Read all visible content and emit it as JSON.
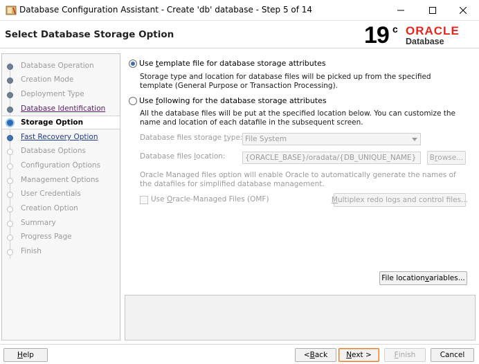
{
  "window": {
    "title": "Database Configuration Assistant - Create 'db' database - Step 5 of 14",
    "controls": [
      "minimize-icon",
      "maximize-icon",
      "close-icon"
    ]
  },
  "header": {
    "page_title": "Select Database Storage Option",
    "logo": {
      "version": "19",
      "version_sup": "c",
      "brand": "ORACLE",
      "product": "Database"
    }
  },
  "sidebar": {
    "steps": [
      {
        "label": "Database Operation",
        "state": "done"
      },
      {
        "label": "Creation Mode",
        "state": "done"
      },
      {
        "label": "Deployment Type",
        "state": "done"
      },
      {
        "label": "Database Identification",
        "state": "visited"
      },
      {
        "label": "Storage Option",
        "state": "current"
      },
      {
        "label": "Fast Recovery Option",
        "state": "next"
      },
      {
        "label": "Database Options",
        "state": "pending"
      },
      {
        "label": "Configuration Options",
        "state": "pending"
      },
      {
        "label": "Management Options",
        "state": "pending"
      },
      {
        "label": "User Credentials",
        "state": "pending"
      },
      {
        "label": "Creation Option",
        "state": "pending"
      },
      {
        "label": "Summary",
        "state": "pending"
      },
      {
        "label": "Progress Page",
        "state": "pending"
      },
      {
        "label": "Finish",
        "state": "pending"
      }
    ]
  },
  "main": {
    "option_template": {
      "pre": "Use ",
      "mnemonic": "t",
      "post": "emplate file for database storage attributes",
      "selected": true,
      "description": "Storage type and location for database files will be picked up from the specified template (General Purpose or Transaction Processing)."
    },
    "option_following": {
      "pre": "Use ",
      "mnemonic": "f",
      "post": "ollowing for the database storage attributes",
      "selected": false,
      "description": "All the database files will be put at the specified location below. You can customize the name and location of each datafile in the subsequent screen."
    },
    "storage_type": {
      "pre": "Database files storage ",
      "mnemonic": "t",
      "post": "ype:",
      "value": "File System"
    },
    "files_location": {
      "pre": "Database files ",
      "mnemonic": "l",
      "post": "ocation:",
      "value": "{ORACLE_BASE}/oradata/{DB_UNIQUE_NAME}"
    },
    "browse": {
      "pre": "B",
      "mnemonic": "r",
      "post": "owse..."
    },
    "omf_note": "Oracle Managed files option will enable Oracle to automatically generate the names of the datafiles for simplified database management.",
    "omf_checkbox": {
      "pre": "Use ",
      "mnemonic": "O",
      "post": "racle-Managed Files (OMF)",
      "checked": false
    },
    "multiplex": {
      "pre": "",
      "mnemonic": "M",
      "post": "ultiplex redo logs and control files..."
    },
    "file_location_vars": {
      "pre": "File location ",
      "mnemonic": "v",
      "post": "ariables..."
    }
  },
  "footer": {
    "help": {
      "pre": "",
      "mnemonic": "H",
      "post": "elp"
    },
    "back": {
      "pre": "< ",
      "mnemonic": "B",
      "post": "ack"
    },
    "next": {
      "pre": "",
      "mnemonic": "N",
      "post": "ext >"
    },
    "finish": {
      "pre": "",
      "mnemonic": "F",
      "post": "inish"
    },
    "cancel": {
      "label": "Cancel"
    }
  },
  "colors": {
    "oracle_red": "#e5261f",
    "current_step": "#2c6bb5",
    "default_button": "#e07b2f"
  }
}
